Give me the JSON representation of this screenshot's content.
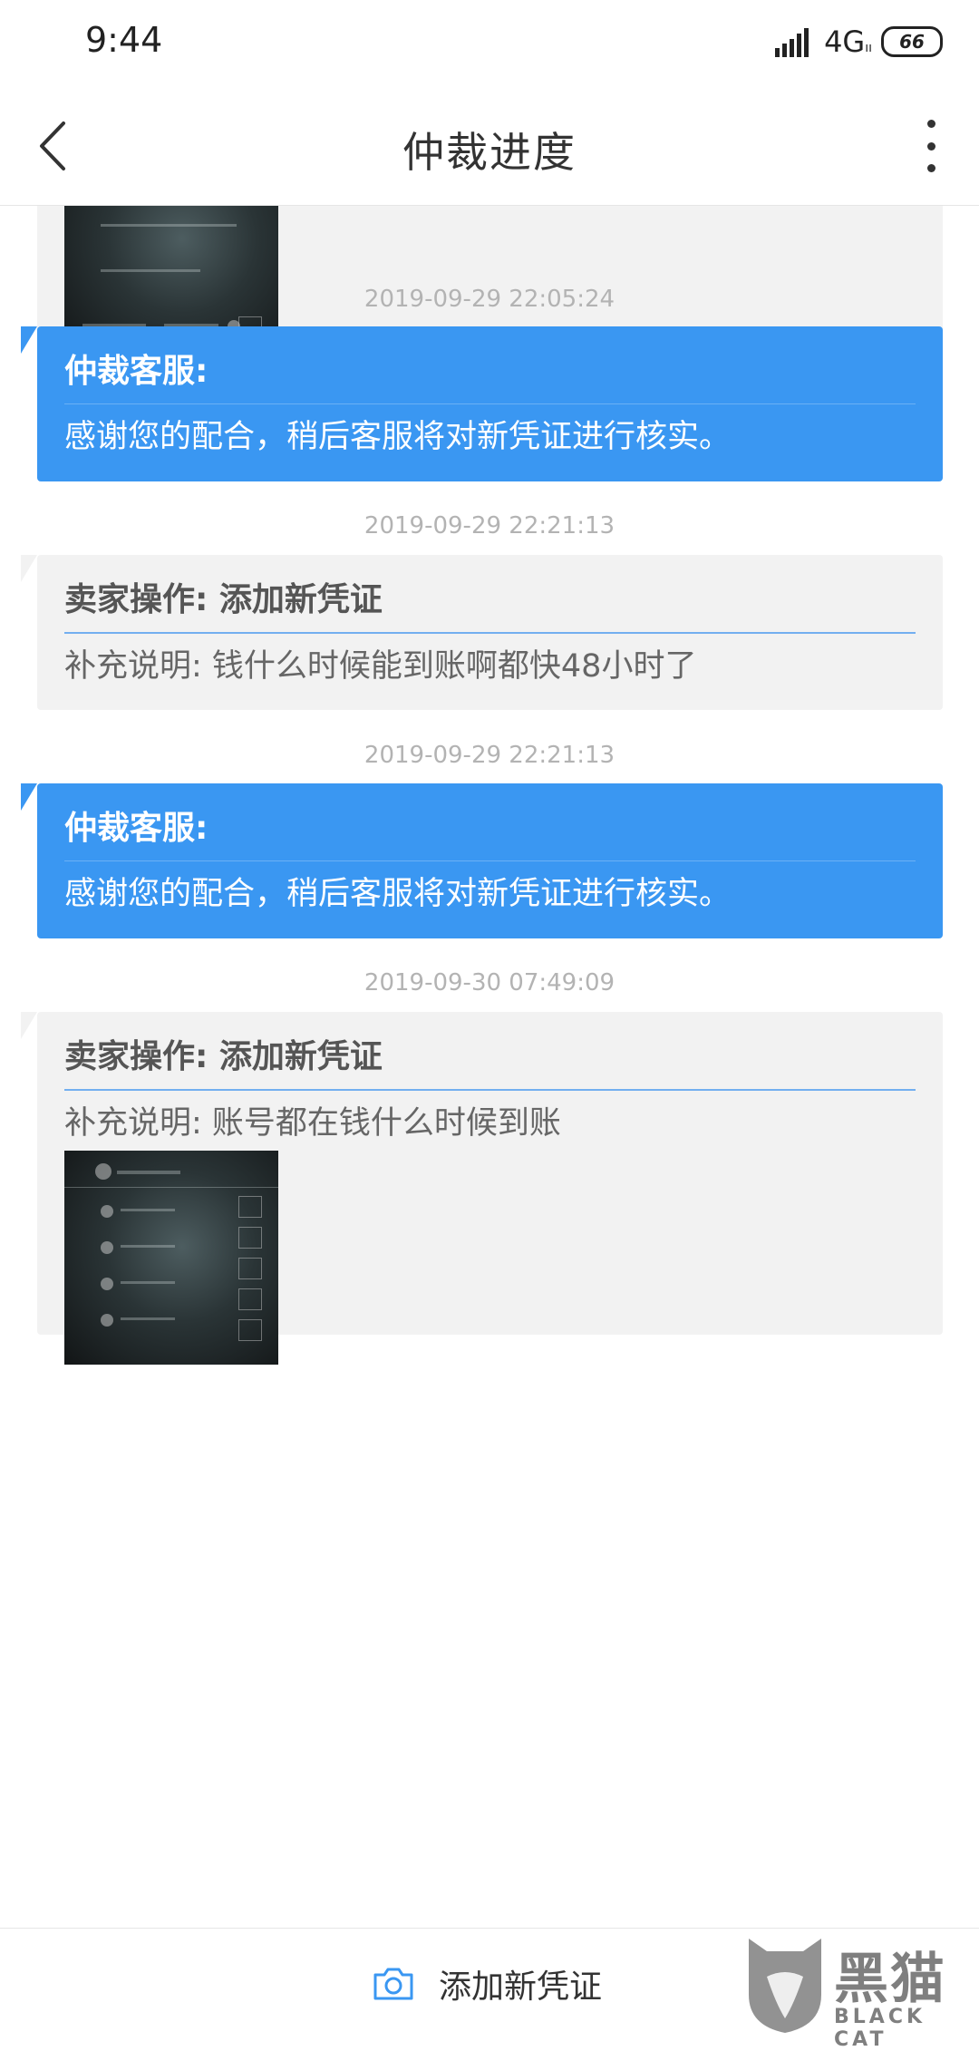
{
  "status_bar": {
    "time": "9:44",
    "network": "4G",
    "battery": "66"
  },
  "header": {
    "title": "仲裁进度"
  },
  "timeline": [
    {
      "type": "seller",
      "images": 1
    },
    {
      "timestamp": "2019-09-29 22:05:24",
      "type": "service",
      "title": "仲裁客服:",
      "text": "感谢您的配合，稍后客服将对新凭证进行核实。"
    },
    {
      "timestamp": "2019-09-29 22:21:13",
      "type": "seller",
      "title": "卖家操作: 添加新凭证",
      "text": "补充说明: 钱什么时候能到账啊都快48小时了"
    },
    {
      "timestamp": "2019-09-29 22:21:13",
      "type": "service",
      "title": "仲裁客服:",
      "text": "感谢您的配合，稍后客服将对新凭证进行核实。"
    },
    {
      "timestamp": "2019-09-30 07:49:09",
      "type": "seller",
      "title": "卖家操作: 添加新凭证",
      "text": "补充说明: 账号都在钱什么时候到账",
      "images": 1
    }
  ],
  "footer": {
    "add_evidence_label": "添加新凭证"
  },
  "watermark": {
    "cn": "黑猫",
    "en": "BLACK CAT"
  },
  "colors": {
    "service_bubble": "#3a97f2",
    "seller_bubble": "#f2f2f2",
    "divider_accent": "#73aff0"
  },
  "icons": {
    "back": "chevron-left-icon",
    "more": "more-vertical-icon",
    "add": "camera-icon"
  }
}
